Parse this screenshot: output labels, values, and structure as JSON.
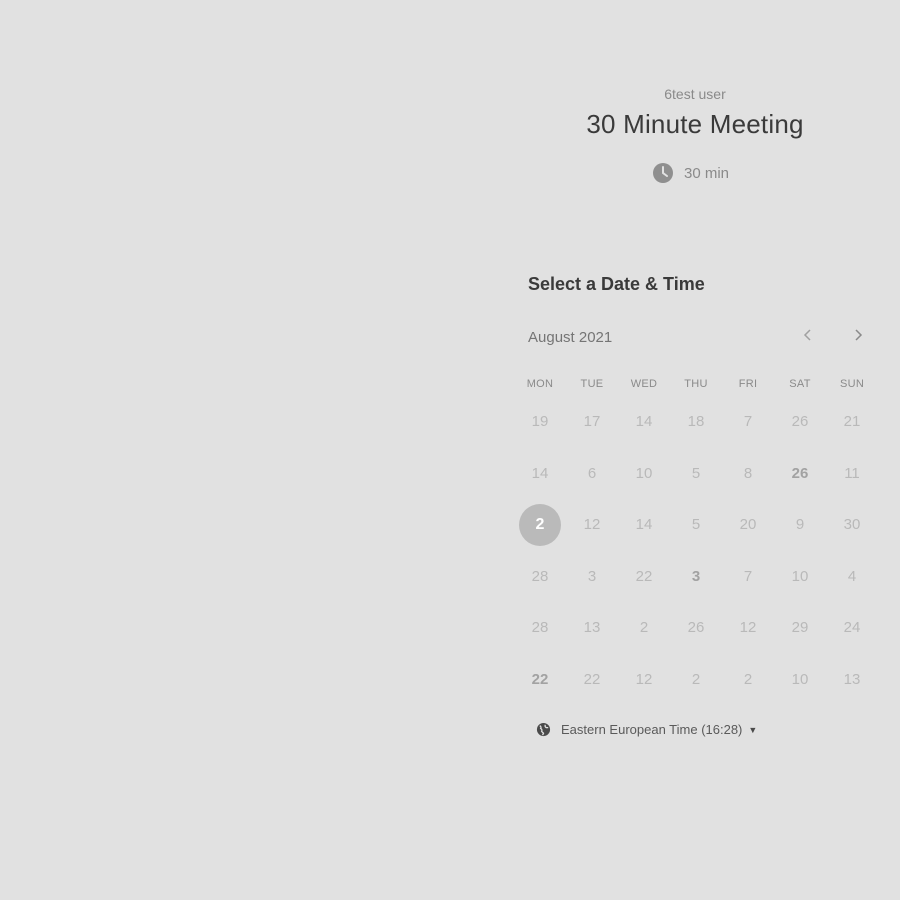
{
  "header": {
    "organizer": "6test user",
    "event_title": "30 Minute Meeting",
    "duration": "30 min",
    "duration_icon": "clock-icon"
  },
  "picker": {
    "section_title": "Select a Date & Time",
    "month_label": "August 2021",
    "prev_icon": "chevron-left-icon",
    "next_icon": "chevron-right-icon",
    "weekdays": [
      "MON",
      "TUE",
      "WED",
      "THU",
      "FRI",
      "SAT",
      "SUN"
    ],
    "weeks": [
      [
        {
          "day": "19"
        },
        {
          "day": "17"
        },
        {
          "day": "14"
        },
        {
          "day": "18"
        },
        {
          "day": "7"
        },
        {
          "day": "26"
        },
        {
          "day": "21"
        }
      ],
      [
        {
          "day": "14"
        },
        {
          "day": "6"
        },
        {
          "day": "10"
        },
        {
          "day": "5"
        },
        {
          "day": "8"
        },
        {
          "day": "26",
          "bold": true
        },
        {
          "day": "11"
        }
      ],
      [
        {
          "day": "2",
          "selected": true
        },
        {
          "day": "12"
        },
        {
          "day": "14"
        },
        {
          "day": "5"
        },
        {
          "day": "20"
        },
        {
          "day": "9"
        },
        {
          "day": "30"
        }
      ],
      [
        {
          "day": "28"
        },
        {
          "day": "3"
        },
        {
          "day": "22"
        },
        {
          "day": "3",
          "bold": true
        },
        {
          "day": "7"
        },
        {
          "day": "10"
        },
        {
          "day": "4"
        }
      ],
      [
        {
          "day": "28"
        },
        {
          "day": "13"
        },
        {
          "day": "2"
        },
        {
          "day": "26"
        },
        {
          "day": "12"
        },
        {
          "day": "29"
        },
        {
          "day": "24"
        }
      ],
      [
        {
          "day": "22",
          "bold": true
        },
        {
          "day": "22"
        },
        {
          "day": "12"
        },
        {
          "day": "2"
        },
        {
          "day": "2"
        },
        {
          "day": "10"
        },
        {
          "day": "13"
        }
      ]
    ]
  },
  "timezone": {
    "label": "Eastern European Time (16:28)",
    "icon": "globe-icon",
    "caret_icon": "caret-down-icon"
  },
  "colors": {
    "background": "#e1e1e1",
    "selected_day": "#bababa",
    "title_text": "#3a3a3a"
  }
}
